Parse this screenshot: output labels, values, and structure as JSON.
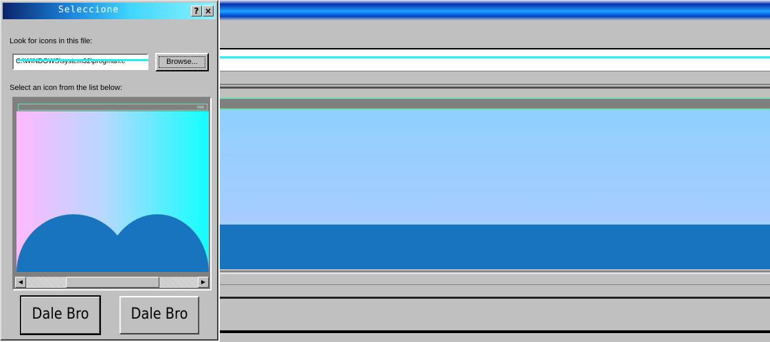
{
  "dialog": {
    "title": "Seleccione",
    "help_glyph": "?",
    "close_glyph": "×",
    "file_label": "Look for icons in this file:",
    "file_value": "C:\\WINDOWS\\system32\\progman.e",
    "browse_label": "Browse...",
    "list_label": "Select an icon from the list below:",
    "scroll_left_glyph": "◀",
    "scroll_right_glyph": "▶",
    "button_1_label": "Dale Bro",
    "button_2_label": "Dale Bro"
  },
  "colors": {
    "dialog_face": "#c0c0c0",
    "title_gradient_start": "#0a246a",
    "title_gradient_end": "#8ef2ff",
    "scribble_cyan": "#1ef2f2",
    "preview_pink": "#ffb8ff",
    "preview_cyan": "#10ffff",
    "hill_blue": "#1874bd",
    "panel_light_blue": "#8ed0ff"
  }
}
